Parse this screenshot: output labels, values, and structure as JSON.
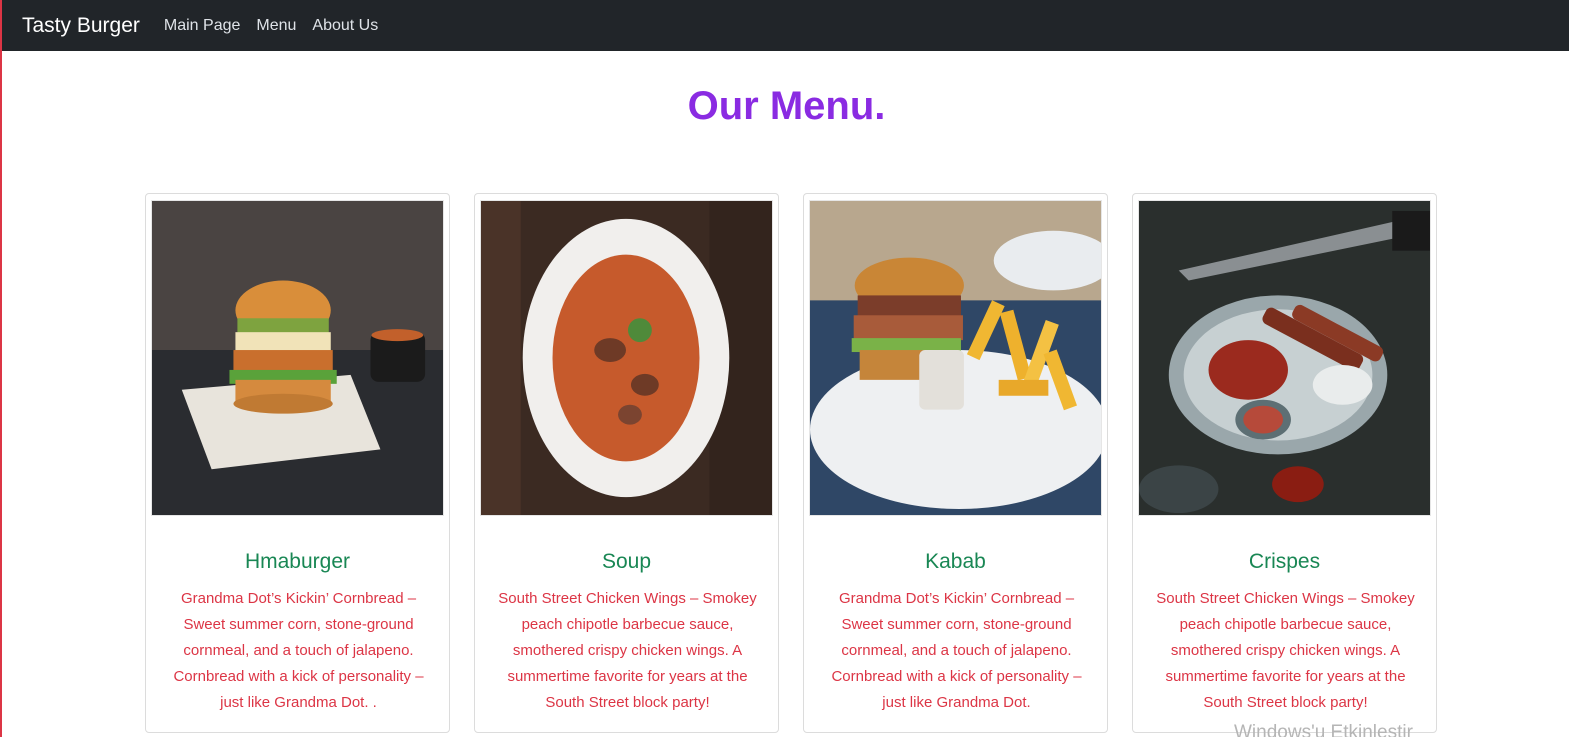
{
  "navbar": {
    "brand": "Tasty Burger",
    "links": [
      "Main Page",
      "Menu",
      "About Us"
    ]
  },
  "heading": "Our Menu.",
  "cards": [
    {
      "title": "Hmaburger",
      "text": "Grandma Dot’s Kickin’ Cornbread – Sweet summer corn, stone-ground cornmeal, and a touch of jalapeno. Cornbread with a kick of personality – just like Grandma Dot. ."
    },
    {
      "title": "Soup",
      "text": "South Street Chicken Wings – Smokey peach chipotle barbecue sauce, smothered crispy chicken wings. A summertime favorite for years at the South Street block party!"
    },
    {
      "title": "Kabab",
      "text": "Grandma Dot’s Kickin’ Cornbread – Sweet summer corn, stone-ground cornmeal, and a touch of jalapeno. Cornbread with a kick of personality – just like Grandma Dot."
    },
    {
      "title": "Crispes",
      "text": "South Street Chicken Wings – Smokey peach chipotle barbecue sauce, smothered crispy chicken wings. A summertime favorite for years at the South Street block party!"
    }
  ],
  "watermark": "Windows'u Etkinleştir",
  "colors": {
    "navbar_bg": "#212529",
    "heading": "#8a2be2",
    "card_title": "#198754",
    "card_text": "#dc3545"
  }
}
